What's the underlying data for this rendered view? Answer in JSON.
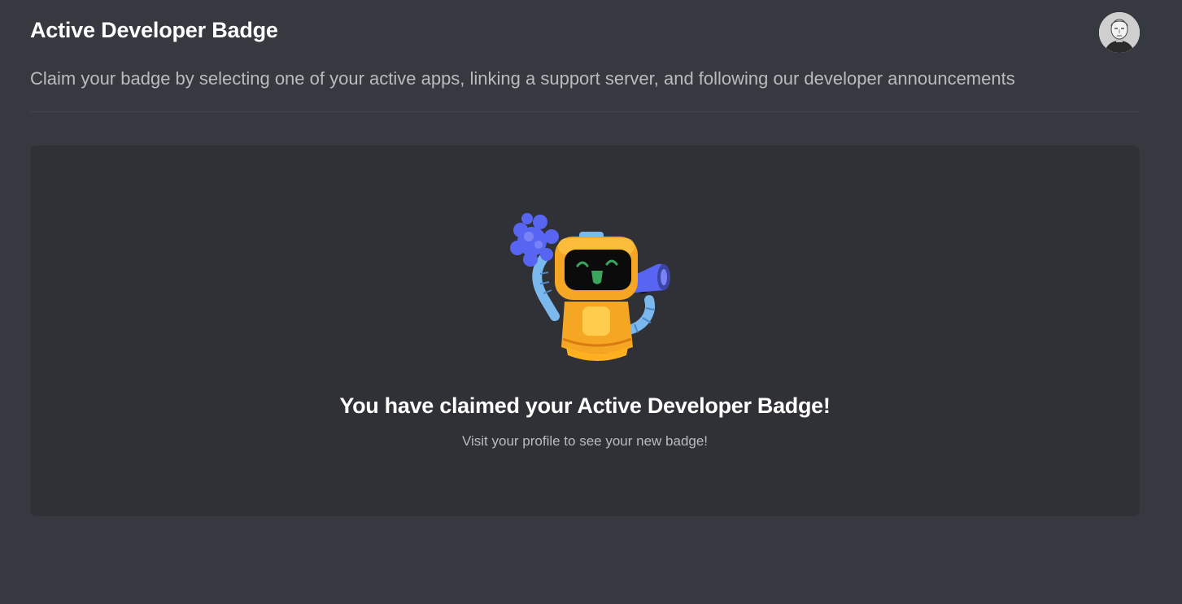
{
  "header": {
    "title": "Active Developer Badge",
    "subtitle": "Claim your badge by selecting one of your active apps, linking a support server, and following our developer announcements"
  },
  "user": {
    "avatar_icon": "user-avatar"
  },
  "status_panel": {
    "title": "You have claimed your Active Developer Badge!",
    "subtitle": "Visit your profile to see your new badge!",
    "illustration": "cheering-robot-with-megaphone-and-pompom"
  },
  "colors": {
    "background": "#36393f",
    "panel": "#2f3136",
    "title_text": "#ffffff",
    "muted_text": "#b9bbbe",
    "robot_orange": "#f5a623",
    "robot_blue": "#5865f2",
    "robot_arm": "#7ab8ee",
    "robot_smile": "#3ba55d"
  }
}
